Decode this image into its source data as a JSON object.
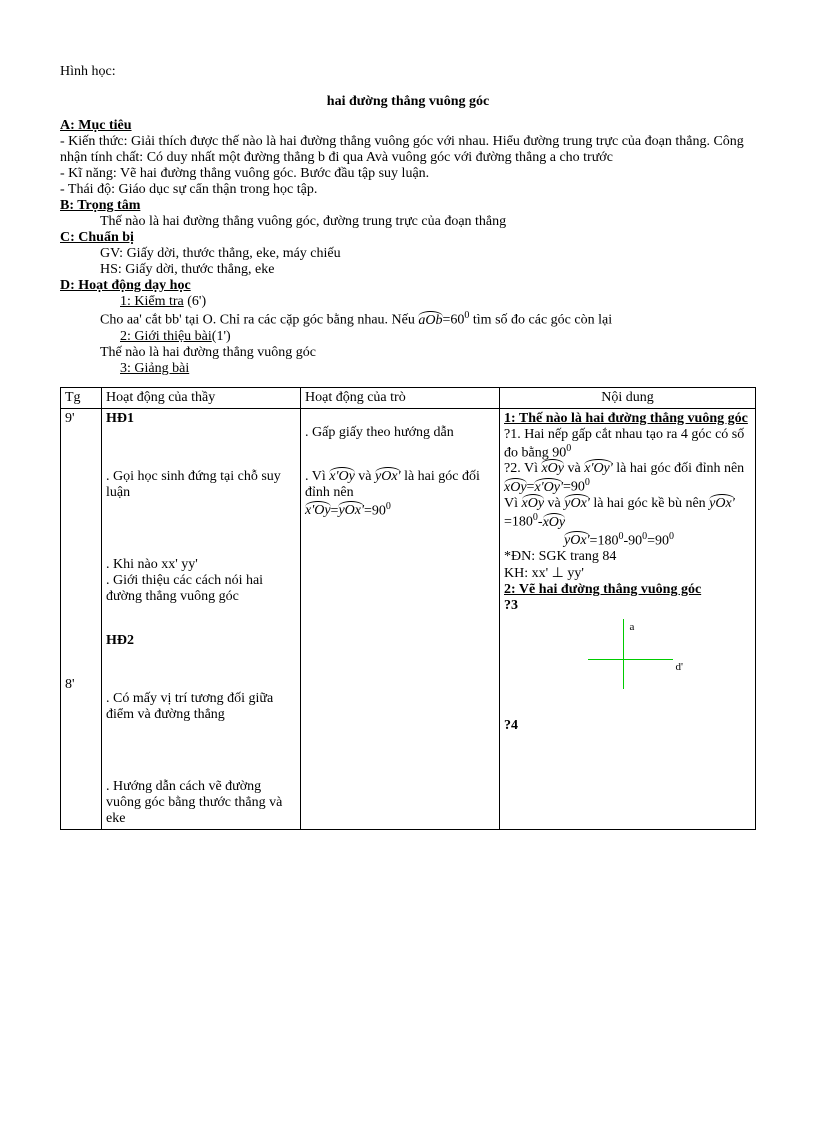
{
  "subject": "Hình học:",
  "title": "hai đường thẳng vuông góc",
  "sectionA": {
    "header": "A: Mục tiêu",
    "lines": [
      "- Kiến thức: Giải thích được thế nào là hai đường thẳng vuông góc với nhau. Hiểu đường trung trực của đoạn thẳng. Công nhận tính chất: Có duy nhất một đường thẳng b đi qua Avà vuông góc với đường thẳng a cho trước",
      "- Kĩ năng: Vẽ hai đường thẳng vuông góc. Bước đầu tập suy luận.",
      "- Thái độ: Giáo dục sự cẩn thận trong học tập."
    ]
  },
  "sectionB": {
    "header": "B: Trọng tâm",
    "line": "Thế nào là hai đường thẳng vuông góc, đường trung trực của đoạn thẳng"
  },
  "sectionC": {
    "header": "C: Chuẩn bị",
    "gv": "GV: Giấy dời, thước thẳng, eke, máy chiếu",
    "hs": "HS: Giấy dời, thước thẳng, eke"
  },
  "sectionD": {
    "header": "D: Hoạt động dạy học",
    "item1": "1: Kiểm tra",
    "item1time": " (6')",
    "item1text_a": "Cho aa' cắt bb' tại O. Chỉ ra các cặp góc bằng nhau. Nếu ",
    "item1angle": "aOb",
    "item1text_b": "=60",
    "item1sup": "0",
    "item1text_c": " tìm số đo các góc còn lại",
    "item2": "2: Giới thiệu bài",
    "item2time": "(1')",
    "item2text": "Thế nào là hai đường thẳng vuông góc",
    "item3": "3: Giảng bài"
  },
  "table": {
    "headers": [
      "Tg",
      "Hoạt động của thầy",
      "Hoạt động của trò",
      "Nội dung"
    ],
    "tg": [
      "9'",
      "8'"
    ],
    "teacher": {
      "hd1": "HĐ1",
      "t1": ". Gọi học sinh đứng tại chỗ suy luận",
      "t2": ". Khi nào xx' yy'",
      "t3": ". Giới thiệu các cách nói hai đường thẳng vuông góc",
      "hd2": "HĐ2",
      "t4": ". Có mấy vị trí tương đối giữa điểm và đường thẳng",
      "t5": ". Hướng dẫn cách vẽ đường vuông góc bằng thước thẳng và eke"
    },
    "student": {
      "s1": ". Gấp giấy theo hướng dẫn",
      "s2a": ". Vì ",
      "s2_angle1": "x'Oy",
      "s2_and": " và ",
      "s2_angle2": "yOx'",
      "s2b": " là hai góc đối đỉnh nên",
      "s3_angle1": "x'Oy",
      "s3_eq": "=",
      "s3_angle2": "yOx'",
      "s3_val": "=90",
      "s3_sup": "0"
    },
    "content": {
      "h1": "1: Thế nào là hai đường thẳng vuông góc",
      "c1a": "?1. Hai nếp gấp cắt nhau tạo ra 4 góc có số đo bằng 90",
      "c1sup": "0",
      "c2a": "?2. Vì ",
      "c2_angle1": "xOy",
      "c2_and": " và ",
      "c2_angle2": "x'Oy'",
      "c2b": " là hai góc đối đỉnh nên",
      "c3_angle1": "xOy",
      "c3_eq": "=",
      "c3_angle2": "x'Oy'",
      "c3_val": "=90",
      "c3_sup": "0",
      "c4a": "Vì ",
      "c4_angle1": "xOy",
      "c4_and": " và ",
      "c4_angle2": "yOx'",
      "c4b": " là hai góc kề bù nên ",
      "c4_angle3": "yOx'",
      "c4_eq": "=180",
      "c4_sup1": "0",
      "c4_minus": "-",
      "c4_angle4": "xOy",
      "c5_angle": "yOx'",
      "c5_eq": "=180",
      "c5_sup1": "0",
      "c5_minus": "-90",
      "c5_sup2": "0",
      "c5_res": "=90",
      "c5_sup3": "0",
      "c6": "*ĐN: SGK trang 84",
      "c7": "KH: xx' ⊥ yy'",
      "h2": "2: Vẽ hai đường thẳng vuông góc",
      "q3": "?3",
      "label_a": "a",
      "label_d": "d'",
      "q4": "?4"
    }
  }
}
